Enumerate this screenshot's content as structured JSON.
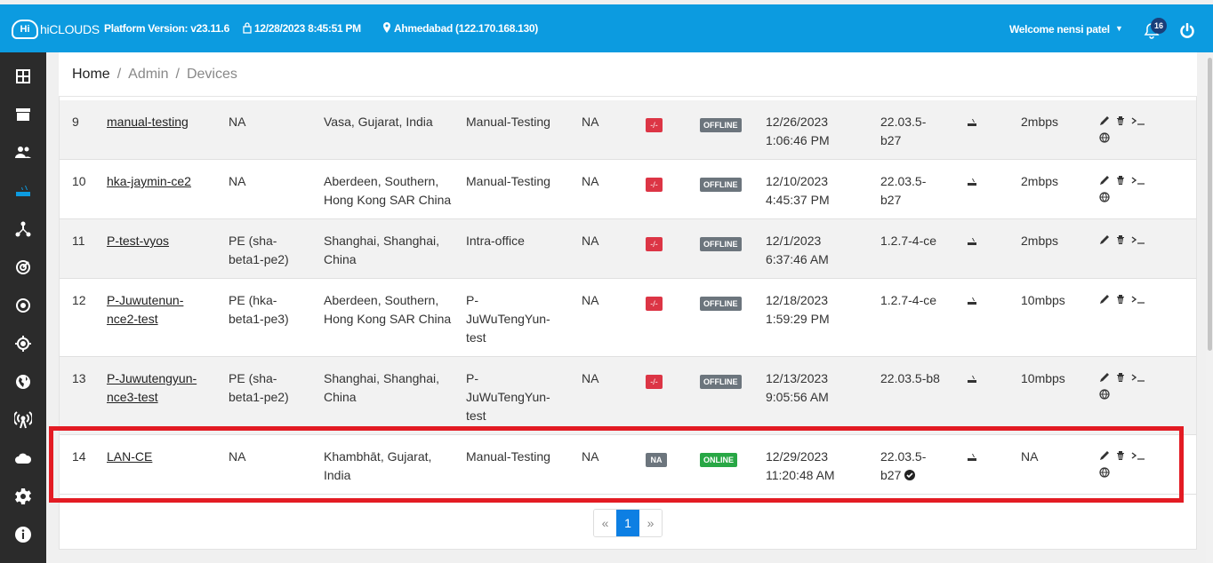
{
  "header": {
    "logo_text": "hiCLOUDS",
    "platform_version": "Platform Version: v23.11.6",
    "datetime": "12/28/2023 8:45:51 PM",
    "location": "Ahmedabad (122.170.168.130)",
    "welcome": "Welcome nensi patel",
    "notification_count": "16"
  },
  "breadcrumb": {
    "home": "Home",
    "sep": "/",
    "admin": "Admin",
    "devices": "Devices"
  },
  "rows": [
    {
      "num": "9",
      "name": "manual-testing",
      "pe": "NA",
      "loc": "Vasa, Gujarat, India",
      "type": "Manual-Testing",
      "na": "NA",
      "tag": "-/-",
      "status": "OFFLINE",
      "date": "12/26/2023 1:06:46 PM",
      "ver": "22.03.5-b27",
      "bw": "2mbps"
    },
    {
      "num": "10",
      "name": "hka-jaymin-ce2",
      "pe": "NA",
      "loc": "Aberdeen, Southern, Hong Kong SAR China",
      "type": "Manual-Testing",
      "na": "NA",
      "tag": "-/-",
      "status": "OFFLINE",
      "date": "12/10/2023 4:45:37 PM",
      "ver": "22.03.5-b27",
      "bw": "2mbps"
    },
    {
      "num": "11",
      "name": "P-test-vyos",
      "pe": "PE (sha-beta1-pe2)",
      "loc": "Shanghai, Shanghai, China",
      "type": "Intra-office",
      "na": "NA",
      "tag": "-/-",
      "status": "OFFLINE",
      "date": "12/1/2023 6:37:46 AM",
      "ver": "1.2.7-4-ce",
      "bw": "2mbps"
    },
    {
      "num": "12",
      "name": "P-Juwutenun-nce2-test",
      "pe": "PE (hka-beta1-pe3)",
      "loc": "Aberdeen, Southern, Hong Kong SAR China",
      "type": "P-JuWuTengYun-test",
      "na": "NA",
      "tag": "-/-",
      "status": "OFFLINE",
      "date": "12/18/2023 1:59:29 PM",
      "ver": "1.2.7-4-ce",
      "bw": "10mbps"
    },
    {
      "num": "13",
      "name": "P-Juwutengyun-nce3-test",
      "pe": "PE (sha-beta1-pe2)",
      "loc": "Shanghai, Shanghai, China",
      "type": "P-JuWuTengYun-test",
      "na": "NA",
      "tag": "-/-",
      "status": "OFFLINE",
      "date": "12/13/2023 9:05:56 AM",
      "ver": "22.03.5-b8",
      "bw": "10mbps"
    },
    {
      "num": "14",
      "name": "LAN-CE",
      "pe": "NA",
      "loc": "Khambhāt, Gujarat, India",
      "type": "Manual-Testing",
      "na": "NA",
      "tag": "NA",
      "status": "ONLINE",
      "date": "12/29/2023 11:20:48 AM",
      "ver": "22.03.5-b27",
      "bw": "NA"
    }
  ],
  "pager": {
    "prev": "«",
    "page": "1",
    "next": "»"
  },
  "colors": {
    "accent": "#0c9be0",
    "offline": "#6c757d",
    "online": "#28a745",
    "danger": "#dc3545",
    "highlight": "#e31b23"
  }
}
